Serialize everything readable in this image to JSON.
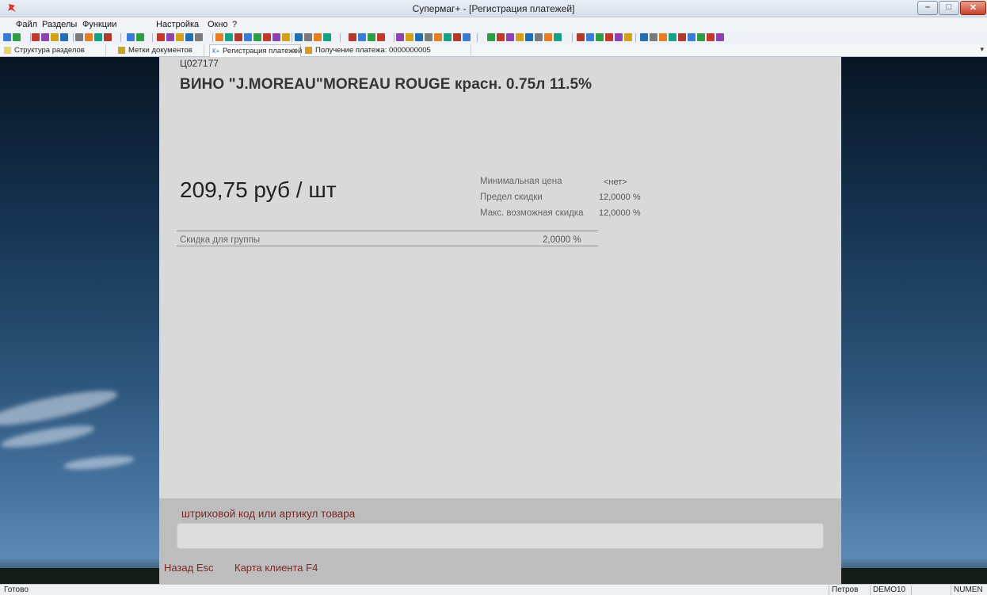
{
  "window": {
    "title": "Супермаг+  - [Регистрация платежей]",
    "icon": "app-logo-icon"
  },
  "menu": {
    "items": [
      "Файл",
      "Разделы",
      "Функции",
      "Настройка",
      "Окно",
      "?"
    ]
  },
  "tabs": [
    {
      "label": "Структура разделов",
      "icon": "structure-icon"
    },
    {
      "label": "Метки документов",
      "icon": "document-marks-icon"
    },
    {
      "label": "Регистрация платежей",
      "icon": "payment-registration-icon",
      "active": true
    },
    {
      "label": "Получение платежа: 0000000005",
      "icon": "payment-receive-icon"
    }
  ],
  "product": {
    "code": "Ц027177",
    "name": "ВИНО \"J.MOREAU\"MOREAU ROUGE красн. 0.75л 11.5%",
    "price": "209,75 руб / шт"
  },
  "info": {
    "min_price_label": "Минимальная цена",
    "min_price_value": "<нет>",
    "limit_label": "Предел скидки",
    "limit_value": "12,0000  %",
    "max_disc_label": "Макс. возможная скидка",
    "max_disc_value": "12,0000  %"
  },
  "group_discount": {
    "label": "Скидка для группы",
    "value": "2,0000  %"
  },
  "input": {
    "label": "штриховой код или артикул товара",
    "value": ""
  },
  "links": {
    "back": "Назад Esc",
    "card": "Карта клиента F4"
  },
  "status": {
    "text": "Готово",
    "user": "Петров",
    "db": "DEMO10",
    "empty": "",
    "mode": "NUMEN"
  },
  "colors": {
    "accent_text": "#7a2a26",
    "panel_bg": "#d9d9d9"
  }
}
